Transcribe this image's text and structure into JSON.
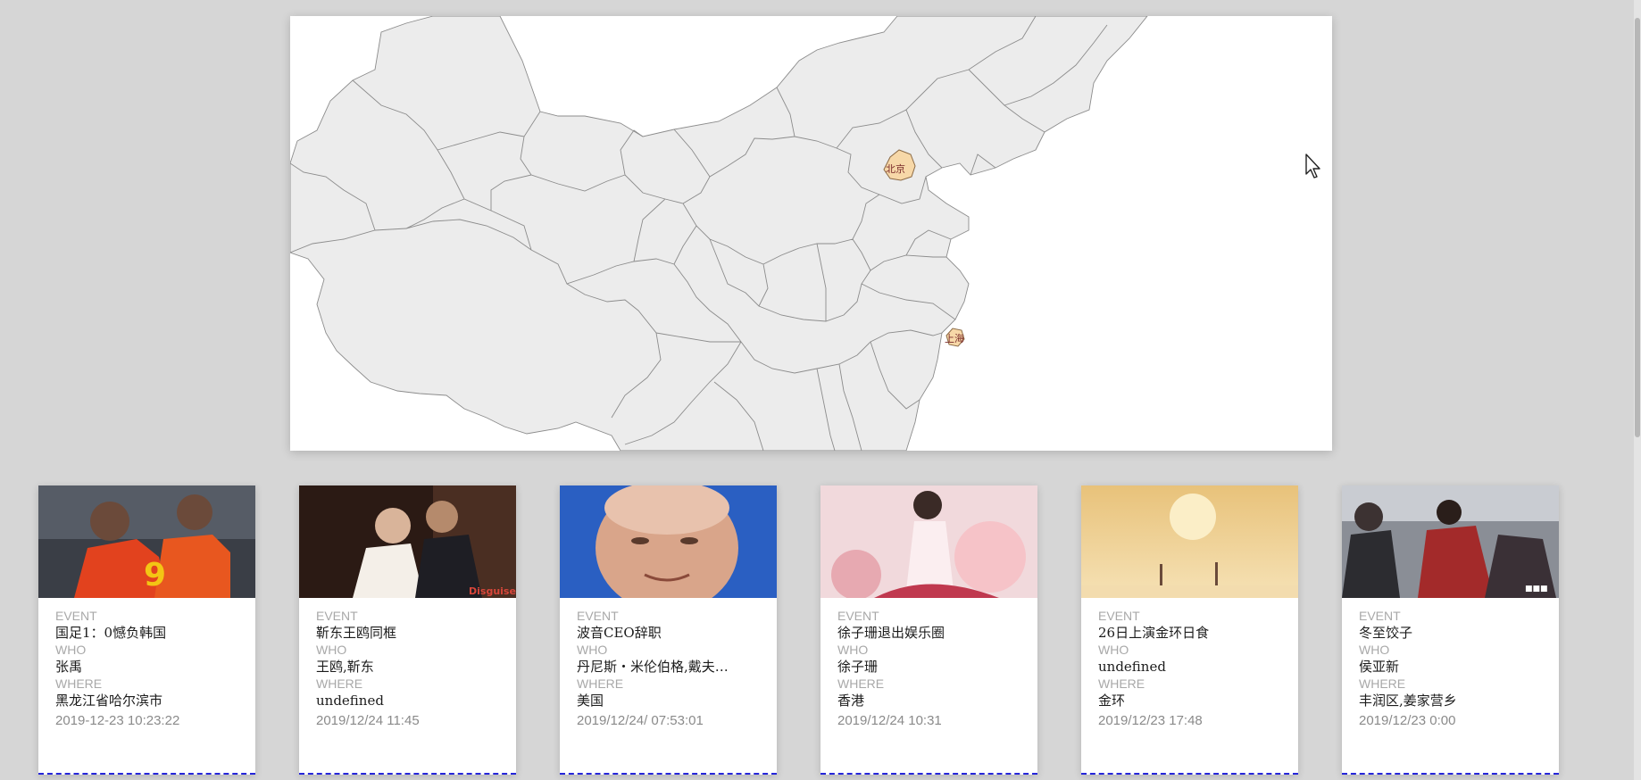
{
  "map": {
    "markers": [
      {
        "name": "北京",
        "label": "北京"
      },
      {
        "name": "上海",
        "label": "上海"
      }
    ]
  },
  "labels": {
    "event": "EVENT",
    "who": "WHO",
    "where": "WHERE"
  },
  "cards": [
    {
      "image": "footballers-photo",
      "event": "国足1：0憾负韩国",
      "who": "张禹",
      "where": "黑龙江省哈尔滨市",
      "time": "2019-12-23 10:23:22"
    },
    {
      "image": "wedding-photo",
      "event": "靳东王鸥同框",
      "who": "王鸥,靳东",
      "where": "undefined",
      "time": "2019/12/24 11:45"
    },
    {
      "image": "portrait-photo",
      "event": "波音CEO辞职",
      "who": "丹尼斯・米伦伯格,戴夫…",
      "where": "美国",
      "time": "2019/12/24/ 07:53:01"
    },
    {
      "image": "woman-photo",
      "event": "徐子珊退出娱乐圈",
      "who": "徐子珊",
      "where": "香港",
      "time": "2019/12/24 10:31"
    },
    {
      "image": "sunset-illustration",
      "event": "26日上演金环日食",
      "who": "undefined",
      "where": "金环",
      "time": "2019/12/23 17:48"
    },
    {
      "image": "crowd-photo",
      "event": "冬至饺子",
      "who": "侯亚新",
      "where": "丰润区,姜家营乡",
      "time": "2019/12/23 0:00"
    }
  ]
}
